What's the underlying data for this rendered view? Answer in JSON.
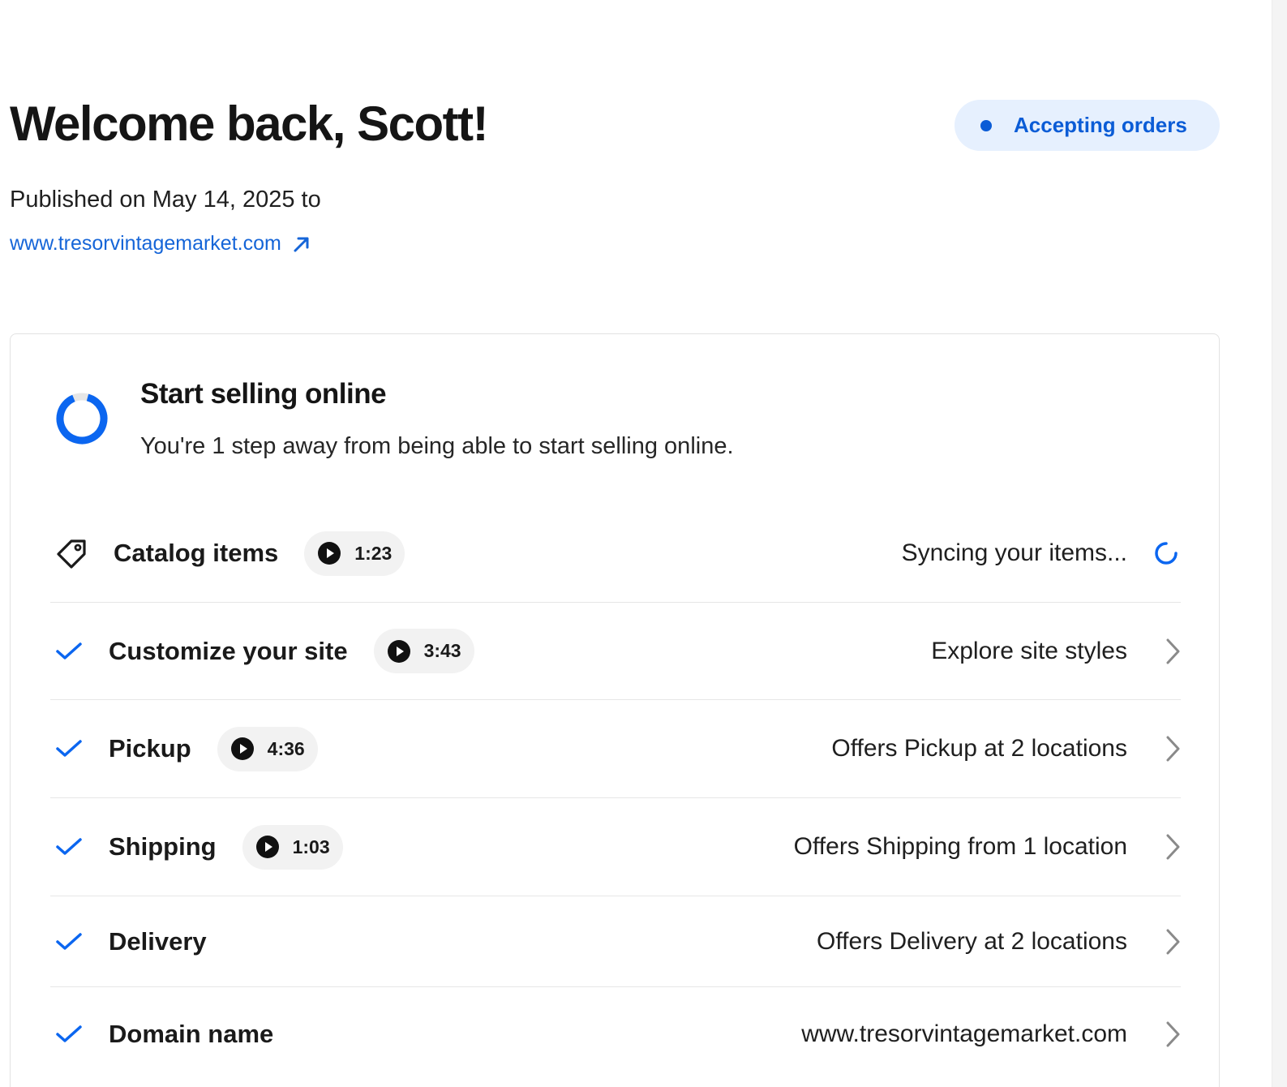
{
  "header": {
    "welcome": "Welcome back, Scott!",
    "status_label": "Accepting orders",
    "published_text": "Published on May 14, 2025 to",
    "site_link": "www.tresorvintagemarket.com"
  },
  "setup": {
    "title": "Start selling online",
    "subtitle": "You're 1 step away from being able to start selling online.",
    "steps": [
      {
        "label": "Catalog items",
        "video_time": "1:23",
        "status": "Syncing your items...",
        "state": "syncing",
        "icon": "tag-icon"
      },
      {
        "label": "Customize your site",
        "video_time": "3:43",
        "status": "Explore site styles",
        "state": "done",
        "icon": "check-icon"
      },
      {
        "label": "Pickup",
        "video_time": "4:36",
        "status": "Offers Pickup at 2 locations",
        "state": "done",
        "icon": "check-icon"
      },
      {
        "label": "Shipping",
        "video_time": "1:03",
        "status": "Offers Shipping from 1 location",
        "state": "done",
        "icon": "check-icon"
      },
      {
        "label": "Delivery",
        "status": "Offers Delivery at 2 locations",
        "state": "done",
        "icon": "check-icon"
      },
      {
        "label": "Domain name",
        "status": "www.tresorvintagemarket.com",
        "state": "done",
        "icon": "check-icon"
      }
    ]
  },
  "colors": {
    "accent": "#0b5cd6",
    "link": "#1565d8",
    "pill_bg": "#e6f0fe",
    "chip_bg": "#f2f2f2"
  }
}
